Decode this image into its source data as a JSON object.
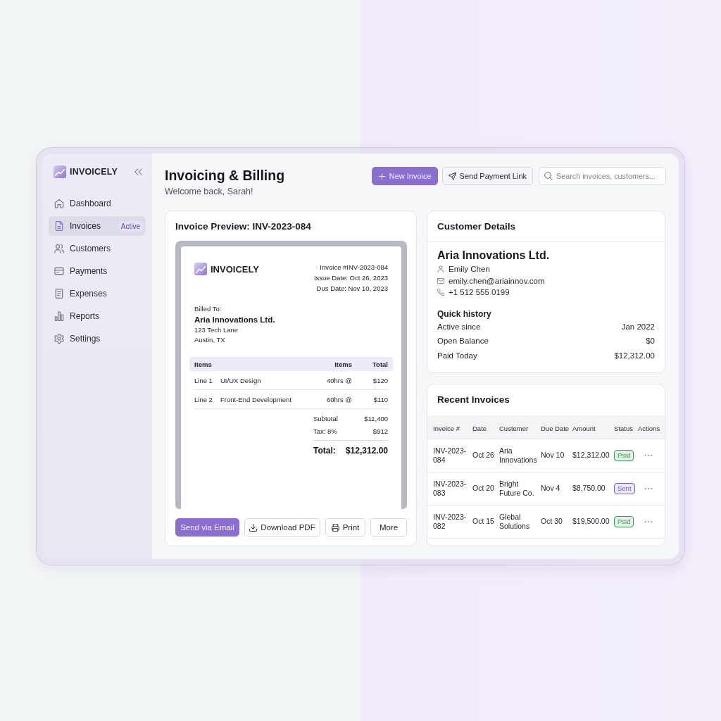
{
  "sidebar": {
    "brand": "INVOICELY",
    "items": [
      {
        "label": "Dashboard",
        "selected": false
      },
      {
        "label": "Invoices",
        "selected": true,
        "badge": "Active"
      },
      {
        "label": "Customers",
        "selected": false
      },
      {
        "label": "Payments",
        "selected": false
      },
      {
        "label": "Expenses",
        "selected": false
      },
      {
        "label": "Reports",
        "selected": false
      },
      {
        "label": "Settings",
        "selected": false
      }
    ]
  },
  "header": {
    "title": "Invoicing & Billing",
    "subtitle": "Welcome back, Sarah!",
    "buttons": [
      {
        "label": "New Invoice",
        "kind": "primary"
      },
      {
        "label": "Send Payment Link",
        "kind": "secondary"
      }
    ],
    "search": {
      "placeholder": "Search invoices, customers..."
    }
  },
  "invoice_preview": {
    "title": "Invoice Preview: INV-2023-084",
    "document": {
      "brand": "INVOICELY",
      "meta": [
        "Invoice #INV-2023-084",
        "Issue Date: Oct 26, 2023",
        "Dus Date: Nov 10, 2023"
      ],
      "billed_to_label": "Billed To:",
      "client": "Aria Innovations Ltd.",
      "address": [
        "123 Tech Lane",
        "Austin, TX"
      ],
      "columns": [
        "Items",
        "Items",
        "Total"
      ],
      "lines": [
        {
          "line": "Line 1",
          "description": "UI/UX Design",
          "quantity": "40hrs @",
          "total": "$120"
        },
        {
          "line": "Line 2",
          "description": "Front-End Development",
          "quantity": "60hrs @",
          "total": "$110"
        }
      ],
      "totals": [
        {
          "label": "Subtotal",
          "value": "$11,400",
          "kind": "sub"
        },
        {
          "label": "Tax: 8%",
          "value": "$912",
          "kind": "sub"
        },
        {
          "label": "Total:",
          "value": "$12,312.00",
          "kind": "grand"
        }
      ]
    },
    "actions": [
      {
        "label": "Send via Email",
        "kind": "primary"
      },
      {
        "label": "Download PDF",
        "kind": "secondary"
      },
      {
        "label": "Print",
        "kind": "secondary"
      },
      {
        "label": "More",
        "kind": "secondary"
      }
    ]
  },
  "customer_details": {
    "title": "Customer Details",
    "name": "Aria Innovations Ltd.",
    "contacts": [
      "Emily Chen",
      "emily.chen@ariainnov.com",
      "+1 512 555 0199"
    ],
    "history_title": "Quick history",
    "history": [
      {
        "label": "Active since",
        "value": "Jan 2022"
      },
      {
        "label": "Open Balance",
        "value": "$0"
      },
      {
        "label": "Paid Today",
        "value": "$12,312.00"
      }
    ]
  },
  "recent_invoices": {
    "title": "Recent Invoices",
    "columns": [
      "Inveice #",
      "Date",
      "Custemer",
      "Due Date",
      "Amount",
      "Status",
      "Actions"
    ],
    "rows": [
      {
        "invoice": "INV-2023-084",
        "date": "Oct 26",
        "customer": "Aria Innovations",
        "due": "Nov 10",
        "amount": "$12,312.00",
        "status": "Psid",
        "color": "#3a9a55"
      },
      {
        "invoice": "INV-2023-083",
        "date": "Oct 20",
        "customer": "Bright Future Co.",
        "due": "Nov 4",
        "amount": "$8,750.00",
        "status": "Sent",
        "color": "#7b5cc4"
      },
      {
        "invoice": "INV-2023-082",
        "date": "Oct 15",
        "customer": "Glebal Solutions",
        "due": "Oct 30",
        "amount": "$19,500.00",
        "status": "Psid",
        "color": "#3a9a55"
      }
    ]
  }
}
